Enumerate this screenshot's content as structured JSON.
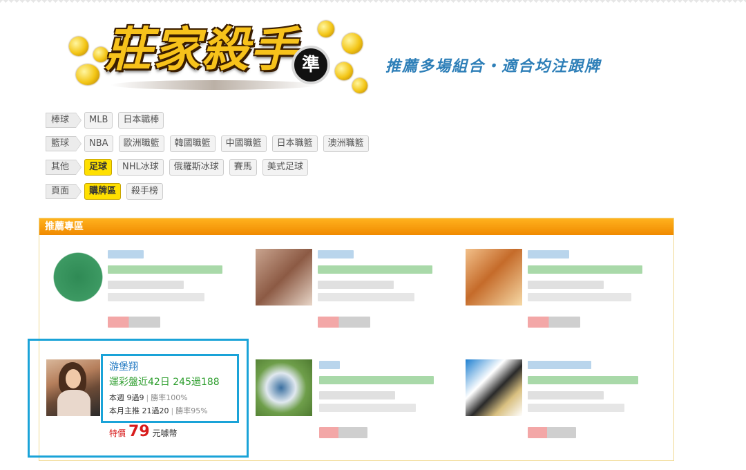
{
  "slogan": "推薦多場組合・適合均注跟牌",
  "logo": {
    "text": "莊家殺手",
    "badge": "準"
  },
  "filters": [
    {
      "category": "棒球",
      "chips": [
        {
          "label": "MLB",
          "active": false
        },
        {
          "label": "日本職棒",
          "active": false
        }
      ]
    },
    {
      "category": "籃球",
      "chips": [
        {
          "label": "NBA",
          "active": false
        },
        {
          "label": "歐洲職籃",
          "active": false
        },
        {
          "label": "韓國職籃",
          "active": false
        },
        {
          "label": "中國職籃",
          "active": false
        },
        {
          "label": "日本職籃",
          "active": false
        },
        {
          "label": "澳洲職籃",
          "active": false
        }
      ]
    },
    {
      "category": "其他",
      "chips": [
        {
          "label": "足球",
          "active": true
        },
        {
          "label": "NHL冰球",
          "active": false
        },
        {
          "label": "俄羅斯冰球",
          "active": false
        },
        {
          "label": "賽馬",
          "active": false
        },
        {
          "label": "美式足球",
          "active": false
        }
      ]
    },
    {
      "category": "頁面",
      "chips": [
        {
          "label": "購牌區",
          "active": true
        },
        {
          "label": "殺手榜",
          "active": false
        }
      ]
    }
  ],
  "panel": {
    "title": "推薦專區"
  },
  "featured": {
    "name": "游堡翔",
    "record": "運彩盤近42日 245過188",
    "week_label": "本週 9過9",
    "week_rate": "勝率100%",
    "month_label": "本月主推 21過20",
    "month_rate": "勝率95%",
    "price_label": "特價",
    "price": "79",
    "price_unit": "元噱幣"
  },
  "colors": {
    "accent_orange": "#f08a00",
    "highlight_blue": "#1aa3d8",
    "chip_active": "#ffe000",
    "record_green": "#2e9e2e"
  }
}
